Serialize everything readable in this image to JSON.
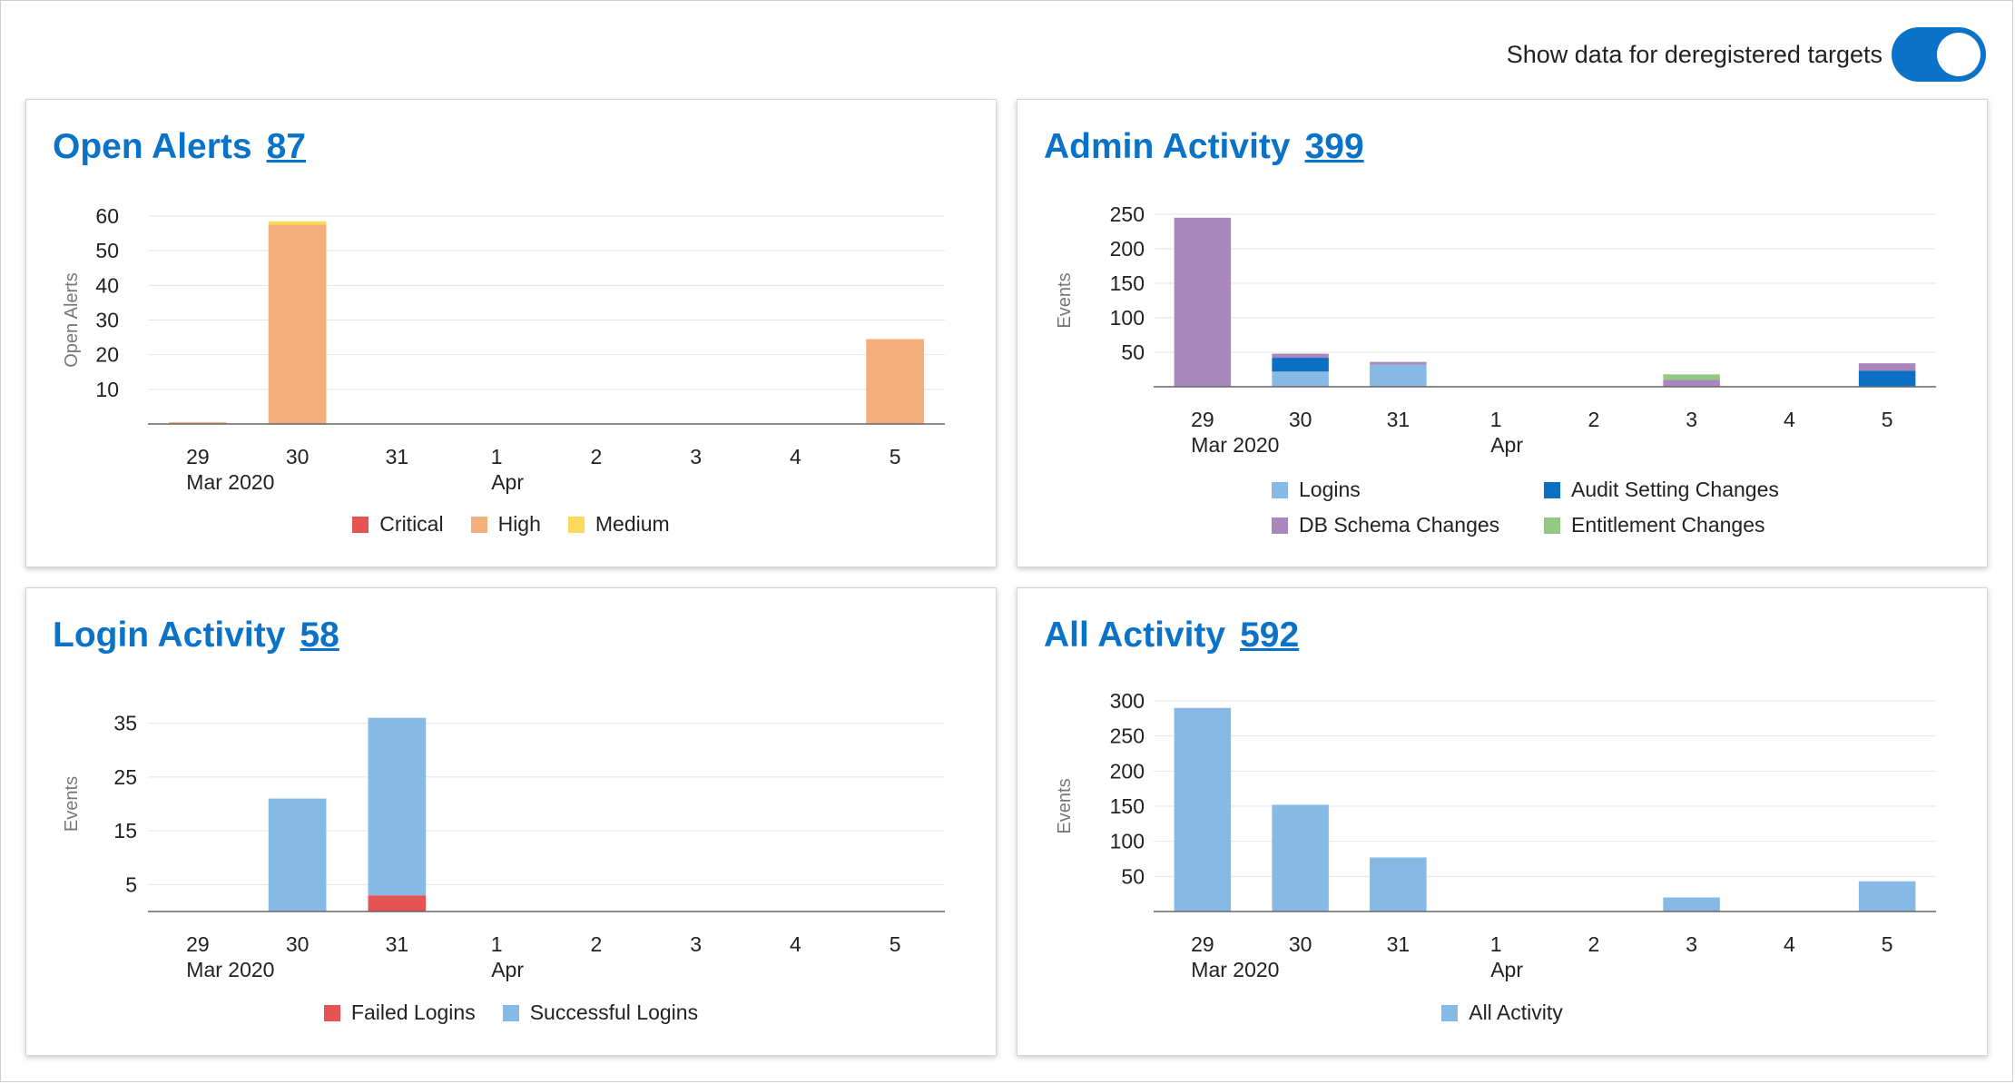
{
  "toggle": {
    "label": "Show data for deregistered targets",
    "state": "on"
  },
  "axis_dates": [
    "29",
    "30",
    "31",
    "1",
    "2",
    "3",
    "4",
    "5"
  ],
  "axis_months": {
    "mar": "Mar 2020",
    "apr": "Apr"
  },
  "panels": {
    "open_alerts": {
      "title": "Open Alerts",
      "count": "87"
    },
    "admin_activity": {
      "title": "Admin Activity",
      "count": "399"
    },
    "login_activity": {
      "title": "Login Activity",
      "count": "58"
    },
    "all_activity": {
      "title": "All Activity",
      "count": "592"
    }
  },
  "chart_data": [
    {
      "id": "open_alerts",
      "type": "bar",
      "stacked": true,
      "categories": [
        "29",
        "30",
        "31",
        "1",
        "2",
        "3",
        "4",
        "5"
      ],
      "ylabel": "Open Alerts",
      "ylim": [
        0,
        60
      ],
      "yticks": [
        10,
        20,
        30,
        40,
        50,
        60
      ],
      "grid": true,
      "legend_placement": "bottom",
      "series": [
        {
          "name": "Critical",
          "color": "#e55353",
          "values": [
            0,
            0,
            0,
            0,
            0,
            0,
            0,
            0
          ]
        },
        {
          "name": "High",
          "color": "#f4ad7c",
          "values": [
            0.5,
            57.5,
            0,
            0,
            0,
            0,
            0,
            24.5
          ]
        },
        {
          "name": "Medium",
          "color": "#fcd95b",
          "values": [
            0,
            1,
            0,
            0,
            0,
            0,
            0,
            0
          ]
        }
      ]
    },
    {
      "id": "admin_activity",
      "type": "bar",
      "stacked": true,
      "categories": [
        "29",
        "30",
        "31",
        "1",
        "2",
        "3",
        "4",
        "5"
      ],
      "ylabel": "Events",
      "ylim": [
        0,
        250
      ],
      "yticks": [
        50,
        100,
        150,
        200,
        250
      ],
      "grid": true,
      "legend_placement": "bottom",
      "series": [
        {
          "name": "Logins",
          "color": "#86b9e3",
          "values": [
            0,
            22,
            32,
            0,
            0,
            0,
            0,
            0
          ]
        },
        {
          "name": "Audit Setting Changes",
          "color": "#0b6fc4",
          "values": [
            0,
            20,
            0,
            0,
            0,
            0,
            0,
            23
          ]
        },
        {
          "name": "DB Schema Changes",
          "color": "#a987bd",
          "values": [
            245,
            6,
            4,
            0,
            0,
            10,
            0,
            11
          ]
        },
        {
          "name": "Entitlement Changes",
          "color": "#94c984",
          "values": [
            0,
            0,
            0,
            0,
            0,
            8,
            0,
            0
          ]
        }
      ]
    },
    {
      "id": "login_activity",
      "type": "bar",
      "stacked": true,
      "categories": [
        "29",
        "30",
        "31",
        "1",
        "2",
        "3",
        "4",
        "5"
      ],
      "ylabel": "Events",
      "ylim": [
        0,
        40
      ],
      "yticks": [
        5,
        15,
        25,
        35
      ],
      "grid": true,
      "legend_placement": "bottom",
      "series": [
        {
          "name": "Failed Logins",
          "color": "#e55353",
          "values": [
            0,
            0,
            3,
            0,
            0,
            0,
            0,
            0
          ]
        },
        {
          "name": "Successful Logins",
          "color": "#86b9e3",
          "values": [
            0,
            21,
            33,
            0,
            0,
            0,
            0,
            0
          ]
        }
      ]
    },
    {
      "id": "all_activity",
      "type": "bar",
      "stacked": false,
      "categories": [
        "29",
        "30",
        "31",
        "1",
        "2",
        "3",
        "4",
        "5"
      ],
      "ylabel": "Events",
      "ylim": [
        0,
        300
      ],
      "yticks": [
        50,
        100,
        150,
        200,
        250,
        300
      ],
      "grid": true,
      "legend_placement": "bottom",
      "series": [
        {
          "name": "All Activity",
          "color": "#86b9e3",
          "values": [
            290,
            152,
            77,
            0,
            0,
            20,
            0,
            43
          ]
        }
      ]
    }
  ]
}
